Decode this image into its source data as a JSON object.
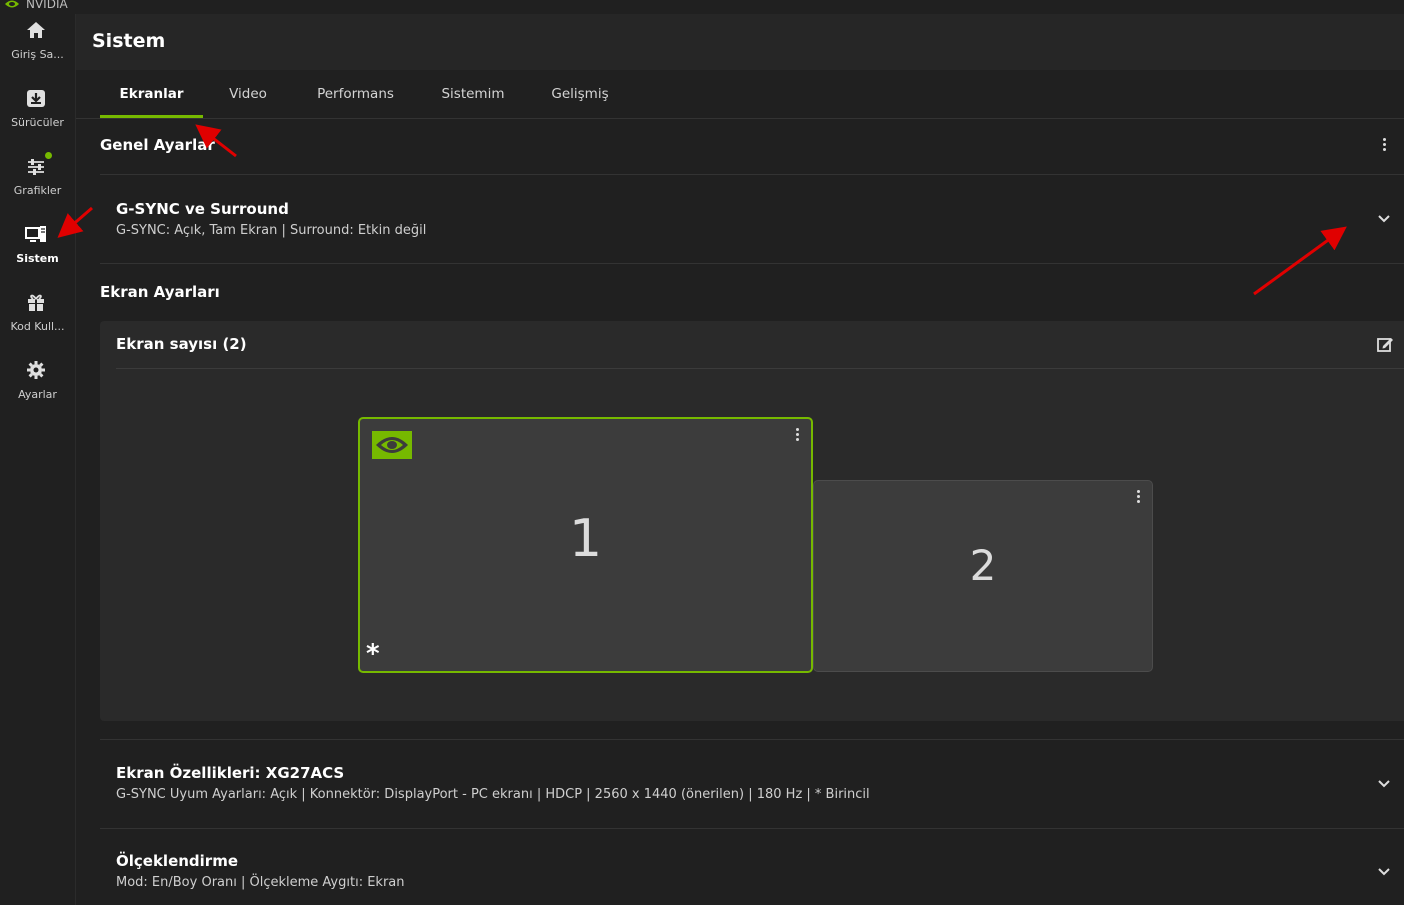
{
  "app": {
    "brand": "NVIDIA",
    "accent": "#76b900"
  },
  "sidebar": {
    "items": [
      {
        "label": "Giriş Sa...",
        "icon": "home-icon"
      },
      {
        "label": "Sürücüler",
        "icon": "download-icon"
      },
      {
        "label": "Grafikler",
        "icon": "sliders-icon"
      },
      {
        "label": "Sistem",
        "icon": "monitor-icon",
        "active": true
      },
      {
        "label": "Kod Kull...",
        "icon": "gift-icon"
      },
      {
        "label": "Ayarlar",
        "icon": "gear-icon"
      }
    ]
  },
  "header": {
    "title": "Sistem"
  },
  "tabs": [
    {
      "label": "Ekranlar",
      "active": true
    },
    {
      "label": "Video"
    },
    {
      "label": "Performans"
    },
    {
      "label": "Sistemim"
    },
    {
      "label": "Gelişmiş"
    }
  ],
  "general": {
    "title": "Genel Ayarlar"
  },
  "gsync": {
    "title": "G-SYNC ve Surround",
    "subtitle": "G-SYNC: Açık, Tam Ekran | Surround: Etkin değil"
  },
  "display_settings": {
    "title": "Ekran Ayarları",
    "card_title": "Ekran sayısı (2)",
    "monitors": [
      {
        "number": "1",
        "primary_marker": "*"
      },
      {
        "number": "2"
      }
    ]
  },
  "display_props": {
    "title": "Ekran Özellikleri: XG27ACS",
    "subtitle": "G-SYNC Uyum Ayarları: Açık | Konnektör: DisplayPort - PC ekranı | HDCP | 2560 x 1440 (önerilen) | 180 Hz | * Birincil"
  },
  "scaling": {
    "title": "Ölçeklendirme",
    "subtitle": "Mod: En/Boy Oranı | Ölçekleme Aygıtı: Ekran"
  }
}
